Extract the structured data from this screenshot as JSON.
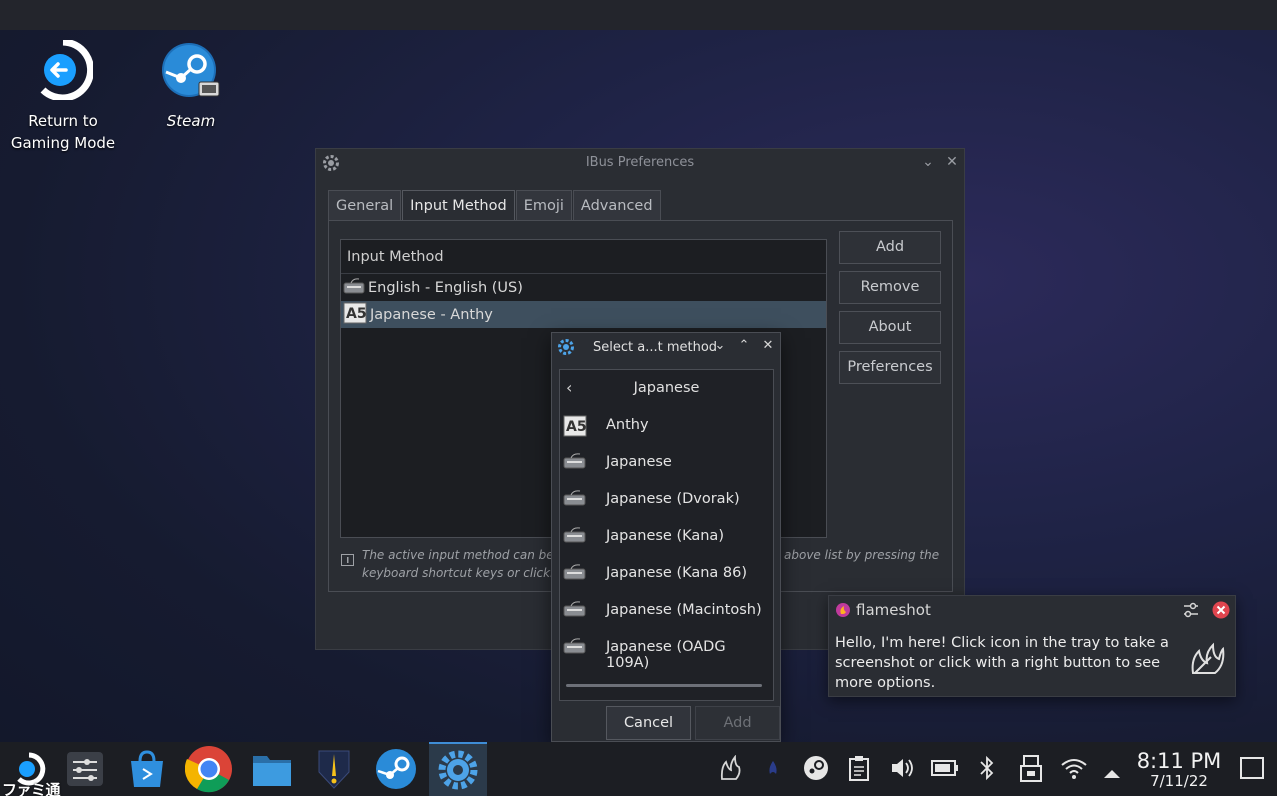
{
  "desktop": {
    "icons": [
      {
        "label_line1": "Return to",
        "label_line2": "Gaming Mode"
      },
      {
        "label": "Steam"
      }
    ]
  },
  "window": {
    "title": "IBus Preferences",
    "tabs": [
      "General",
      "Input Method",
      "Emoji",
      "Advanced"
    ],
    "active_tab": "Input Method",
    "list_header": "Input Method",
    "methods": [
      "English - English (US)",
      "Japanese - Anthy"
    ],
    "selected_method": "Japanese - Anthy",
    "buttons": {
      "add": "Add",
      "remove": "Remove",
      "about": "About",
      "preferences": "Preferences"
    },
    "hint_line1": "The active input method can be swi",
    "hint_line1_right": "above list by pressing the",
    "hint_line2": "keyboard shortcut keys or clicking t"
  },
  "dialog": {
    "title": "Select a...t method",
    "category": "Japanese",
    "items": [
      "Anthy",
      "Japanese",
      "Japanese (Dvorak)",
      "Japanese (Kana)",
      "Japanese (Kana 86)",
      "Japanese (Macintosh)",
      "Japanese (OADG 109A)"
    ],
    "cancel": "Cancel",
    "add": "Add"
  },
  "notification": {
    "app": "flameshot",
    "message": "Hello, I'm here! Click icon in the tray to take a screenshot or click with a right button to see more options."
  },
  "taskbar": {
    "apps": [
      "steam-deck-icon",
      "settings-sliders-icon",
      "discover-store-icon",
      "chrome-icon",
      "file-manager-icon",
      "heroic-icon",
      "steam-icon",
      "ibus-settings-icon"
    ],
    "time": "8:11 PM",
    "date": "7/11/22"
  },
  "watermark": "ファミ通",
  "colors": {
    "accent": "#3f8dd6",
    "selection": "#3e4f5e",
    "close_red": "#e0454f"
  }
}
